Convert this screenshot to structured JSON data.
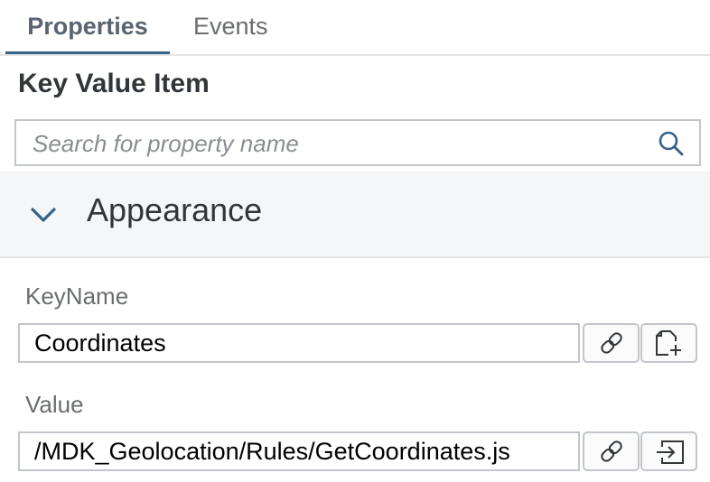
{
  "tabs": [
    {
      "label": "Properties",
      "active": true
    },
    {
      "label": "Events",
      "active": false
    }
  ],
  "section_title": "Key Value Item",
  "search": {
    "placeholder": "Search for property name",
    "value": ""
  },
  "group": {
    "label": "Appearance",
    "expanded": true
  },
  "fields": [
    {
      "label": "KeyName",
      "value": "Coordinates",
      "buttons": [
        "link-icon",
        "new-file-icon"
      ]
    },
    {
      "label": "Value",
      "value": "/MDK_Geolocation/Rules/GetCoordinates.js",
      "buttons": [
        "link-icon",
        "navigate-icon"
      ]
    }
  ],
  "colors": {
    "accent": "#346187",
    "border": "#c2c6ca",
    "group_bg": "#f5f6f7",
    "text": "#32363a",
    "muted": "#6a6d70"
  }
}
